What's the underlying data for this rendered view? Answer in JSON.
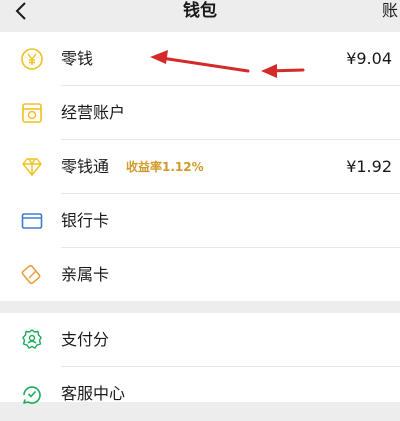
{
  "header": {
    "title": "钱包",
    "right_label": "账"
  },
  "wallet": [
    {
      "label": "零钱",
      "amount": "¥9.04",
      "icon": "coin-icon"
    },
    {
      "label": "经营账户",
      "icon": "business-account-icon"
    },
    {
      "label": "零钱通",
      "badge": "收益率1.12%",
      "amount": "¥1.92",
      "icon": "diamond-icon"
    },
    {
      "label": "银行卡",
      "icon": "bank-card-icon"
    },
    {
      "label": "亲属卡",
      "icon": "family-card-icon"
    }
  ],
  "services": [
    {
      "label": "支付分",
      "icon": "pay-score-icon"
    },
    {
      "label": "客服中心",
      "icon": "customer-service-icon"
    }
  ],
  "colors": {
    "accent_yellow": "#f0c020",
    "accent_orange": "#e8a040",
    "accent_blue": "#3b7ed1",
    "accent_green": "#1aad5a",
    "badge": "#d19a2a",
    "annotation_arrow": "#d42a2a"
  }
}
